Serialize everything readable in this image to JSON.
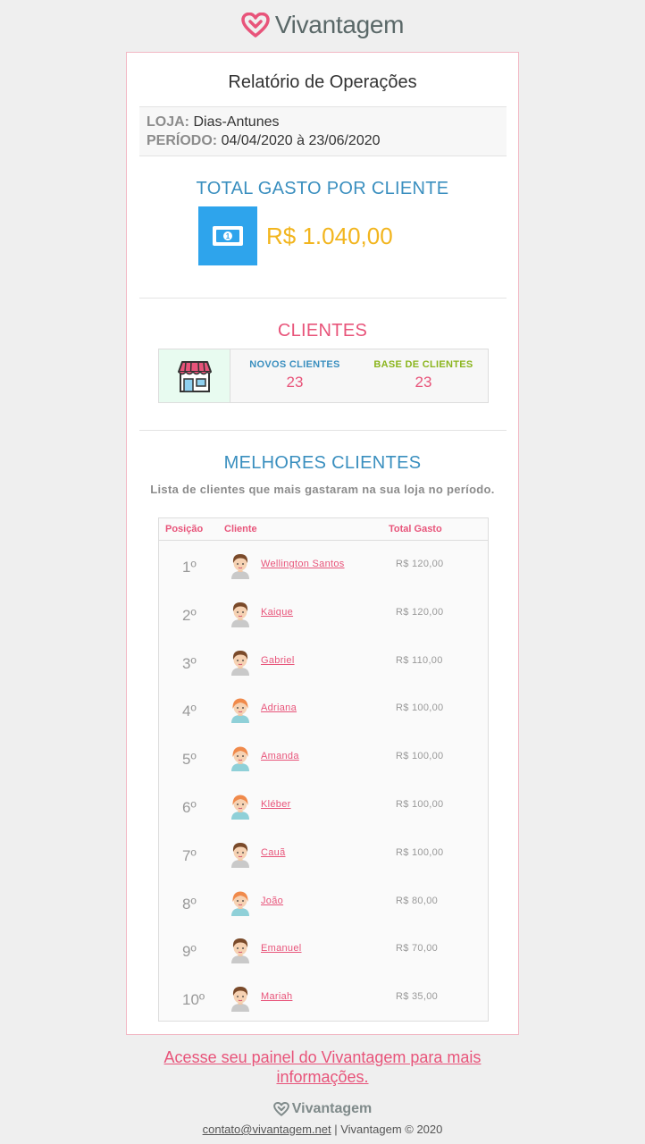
{
  "header": {
    "brand": "Vivantagem"
  },
  "report": {
    "title": "Relatório de Operações",
    "store_label": "LOJA:",
    "store_value": "Dias-Antunes",
    "period_label": "PERÍODO:",
    "period_value": "04/04/2020 à 23/06/2020"
  },
  "total_spent": {
    "title": "TOTAL GASTO POR CLIENTE",
    "value": "R$ 1.040,00",
    "icon": "money-bill-icon"
  },
  "clients": {
    "title": "CLIENTES",
    "icon": "store-icon",
    "new_label": "NOVOS CLIENTES",
    "new_value": "23",
    "base_label": "BASE DE CLIENTES",
    "base_value": "23"
  },
  "best_clients": {
    "title": "MELHORES CLIENTES",
    "subtitle": "Lista de clientes que mais gastaram na sua loja no período.",
    "columns": [
      "Posição",
      "Cliente",
      "Total Gasto"
    ],
    "rows": [
      {
        "position": "1º",
        "name": "Wellington Santos",
        "amount": "R$ 120,00",
        "avatar": "male-avatar-icon"
      },
      {
        "position": "2º",
        "name": "Kaique",
        "amount": "R$ 120,00",
        "avatar": "male-avatar-icon"
      },
      {
        "position": "3º",
        "name": "Gabriel",
        "amount": "R$ 110,00",
        "avatar": "male-avatar-icon"
      },
      {
        "position": "4º",
        "name": "Adriana",
        "amount": "R$ 100,00",
        "avatar": "female-avatar-icon"
      },
      {
        "position": "5º",
        "name": "Amanda",
        "amount": "R$ 100,00",
        "avatar": "female-avatar-icon"
      },
      {
        "position": "6º",
        "name": "Kléber",
        "amount": "R$ 100,00",
        "avatar": "female-avatar-icon"
      },
      {
        "position": "7º",
        "name": "Cauã",
        "amount": "R$ 100,00",
        "avatar": "male-avatar-icon"
      },
      {
        "position": "8º",
        "name": "João",
        "amount": "R$ 80,00",
        "avatar": "female-avatar-icon"
      },
      {
        "position": "9º",
        "name": "Emanuel",
        "amount": "R$ 70,00",
        "avatar": "male-avatar-icon"
      },
      {
        "position": "10º",
        "name": "Mariah",
        "amount": "R$ 35,00",
        "avatar": "male-avatar-icon"
      }
    ]
  },
  "cta": {
    "text": "Acesse seu painel do Vivantagem para mais informações."
  },
  "footer": {
    "brand": "Vivantagem",
    "email": "contato@vivantagem.net",
    "separator": " | ",
    "copyright": "Vivantagem © 2020"
  },
  "colors": {
    "pink": "#e8547a",
    "blue": "#3a8fbf",
    "gold": "#f2b51e",
    "green": "#8bb51e",
    "money_blue": "#2ea4ec"
  }
}
